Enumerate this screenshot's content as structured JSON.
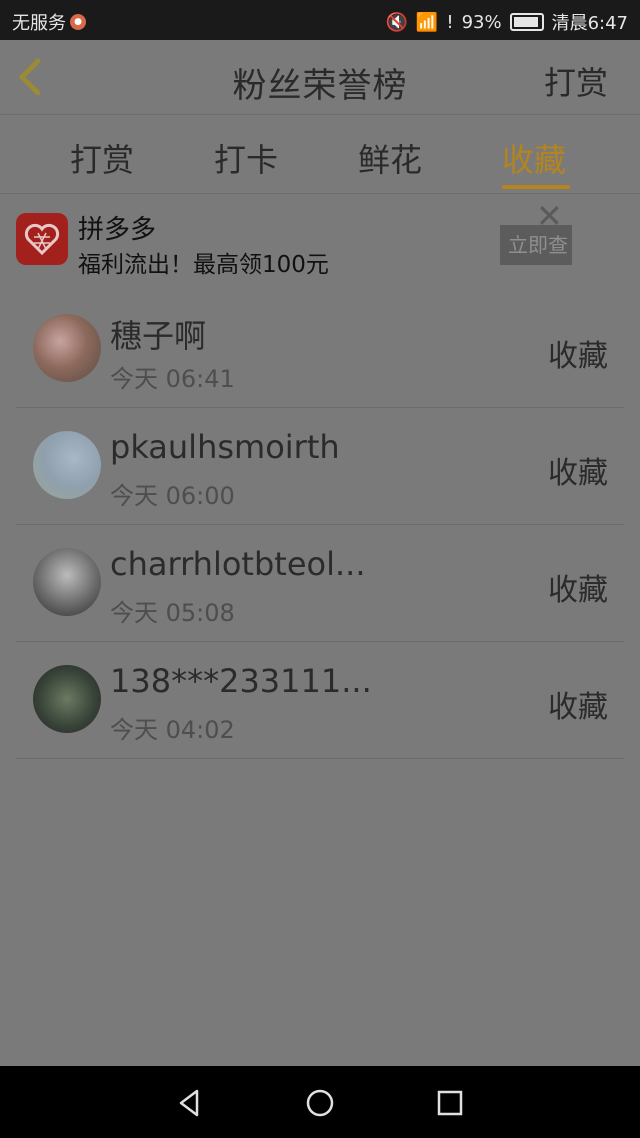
{
  "status_bar": {
    "carrier": "无服务",
    "battery_percent": "93%",
    "time": "清晨6:47",
    "icons": [
      "mute-icon",
      "wifi-icon",
      "alert-icon",
      "battery-icon",
      "app-badge-icon"
    ]
  },
  "header": {
    "title": "粉丝荣誉榜",
    "right_action": "打赏",
    "back_icon": "chevron-left-icon"
  },
  "tabs": [
    {
      "label": "打赏",
      "active": false
    },
    {
      "label": "打卡",
      "active": false
    },
    {
      "label": "鲜花",
      "active": false
    },
    {
      "label": "收藏",
      "active": true
    }
  ],
  "ad": {
    "title": "拼多多",
    "subtitle": "福利流出！最高领100元",
    "button_label": "立即查",
    "close_icon": "close-icon"
  },
  "list": [
    {
      "name": "穗子啊",
      "time": "今天 06:41",
      "action": "收藏"
    },
    {
      "name": "pkaulhsmoirth",
      "time": "今天 06:00",
      "action": "收藏"
    },
    {
      "name": "charrhlotbteol...",
      "time": "今天 05:08",
      "action": "收藏"
    },
    {
      "name": "138***233111...",
      "time": "今天 04:02",
      "action": "收藏"
    }
  ],
  "colors": {
    "accent": "#b4841e",
    "overlay_bg": "#7a7a7a",
    "back_arrow": "#9b8a36"
  }
}
